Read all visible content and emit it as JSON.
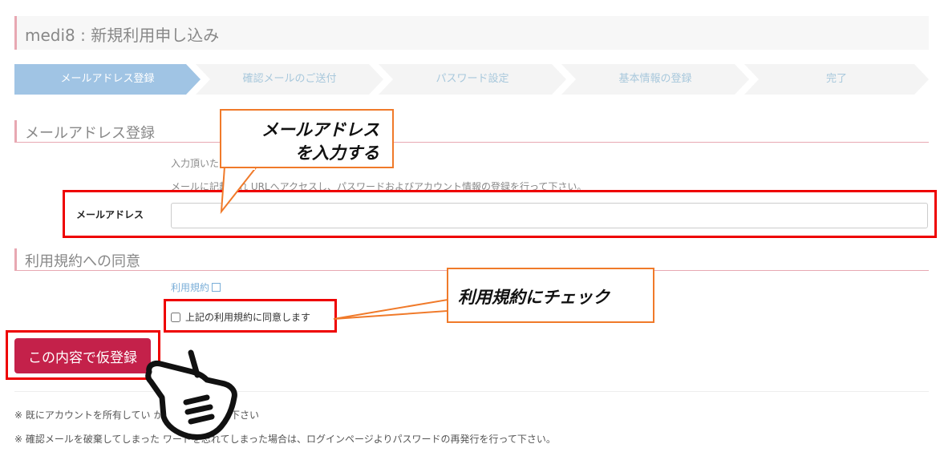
{
  "page": {
    "title": "medi8 : 新規利用申し込み"
  },
  "steps": [
    {
      "label": "メールアドレス登録",
      "active": true
    },
    {
      "label": "確認メールのご送付",
      "active": false
    },
    {
      "label": "パスワード設定",
      "active": false
    },
    {
      "label": "基本情報の登録",
      "active": false
    },
    {
      "label": "完了",
      "active": false
    }
  ],
  "email_section": {
    "heading": "メールアドレス登録",
    "note1": "入力頂いた                                                確認用のメールをご送付致します。",
    "note2": "メールに記載され      URLへアクセスし、パスワードおよびアカウント情報の登録を行って下さい。",
    "field_label": "メールアドレス",
    "field_value": "",
    "field_placeholder": ""
  },
  "terms_section": {
    "heading": "利用規約への同意",
    "link_text": "利用規約",
    "checkbox_label": "上記の利用規約に同意します",
    "checked": false
  },
  "submit": {
    "label": "この内容で仮登録"
  },
  "footer": {
    "note1": "※ 既にアカウントを所有してい                      からログインして下さい",
    "note2": "※ 確認メールを破棄してしまった           ワードを忘れてしまった場合は、ログインページよりパスワードの再発行を行って下さい。"
  },
  "annotations": {
    "callout_email_line1": "メールアドレス",
    "callout_email_line2": "を入力する",
    "callout_terms": "利用規約にチェック"
  },
  "colors": {
    "accent": "#c4214a",
    "step_active": "#a0c4e4",
    "highlight": "#e00000",
    "callout_border": "#f07a2a"
  }
}
